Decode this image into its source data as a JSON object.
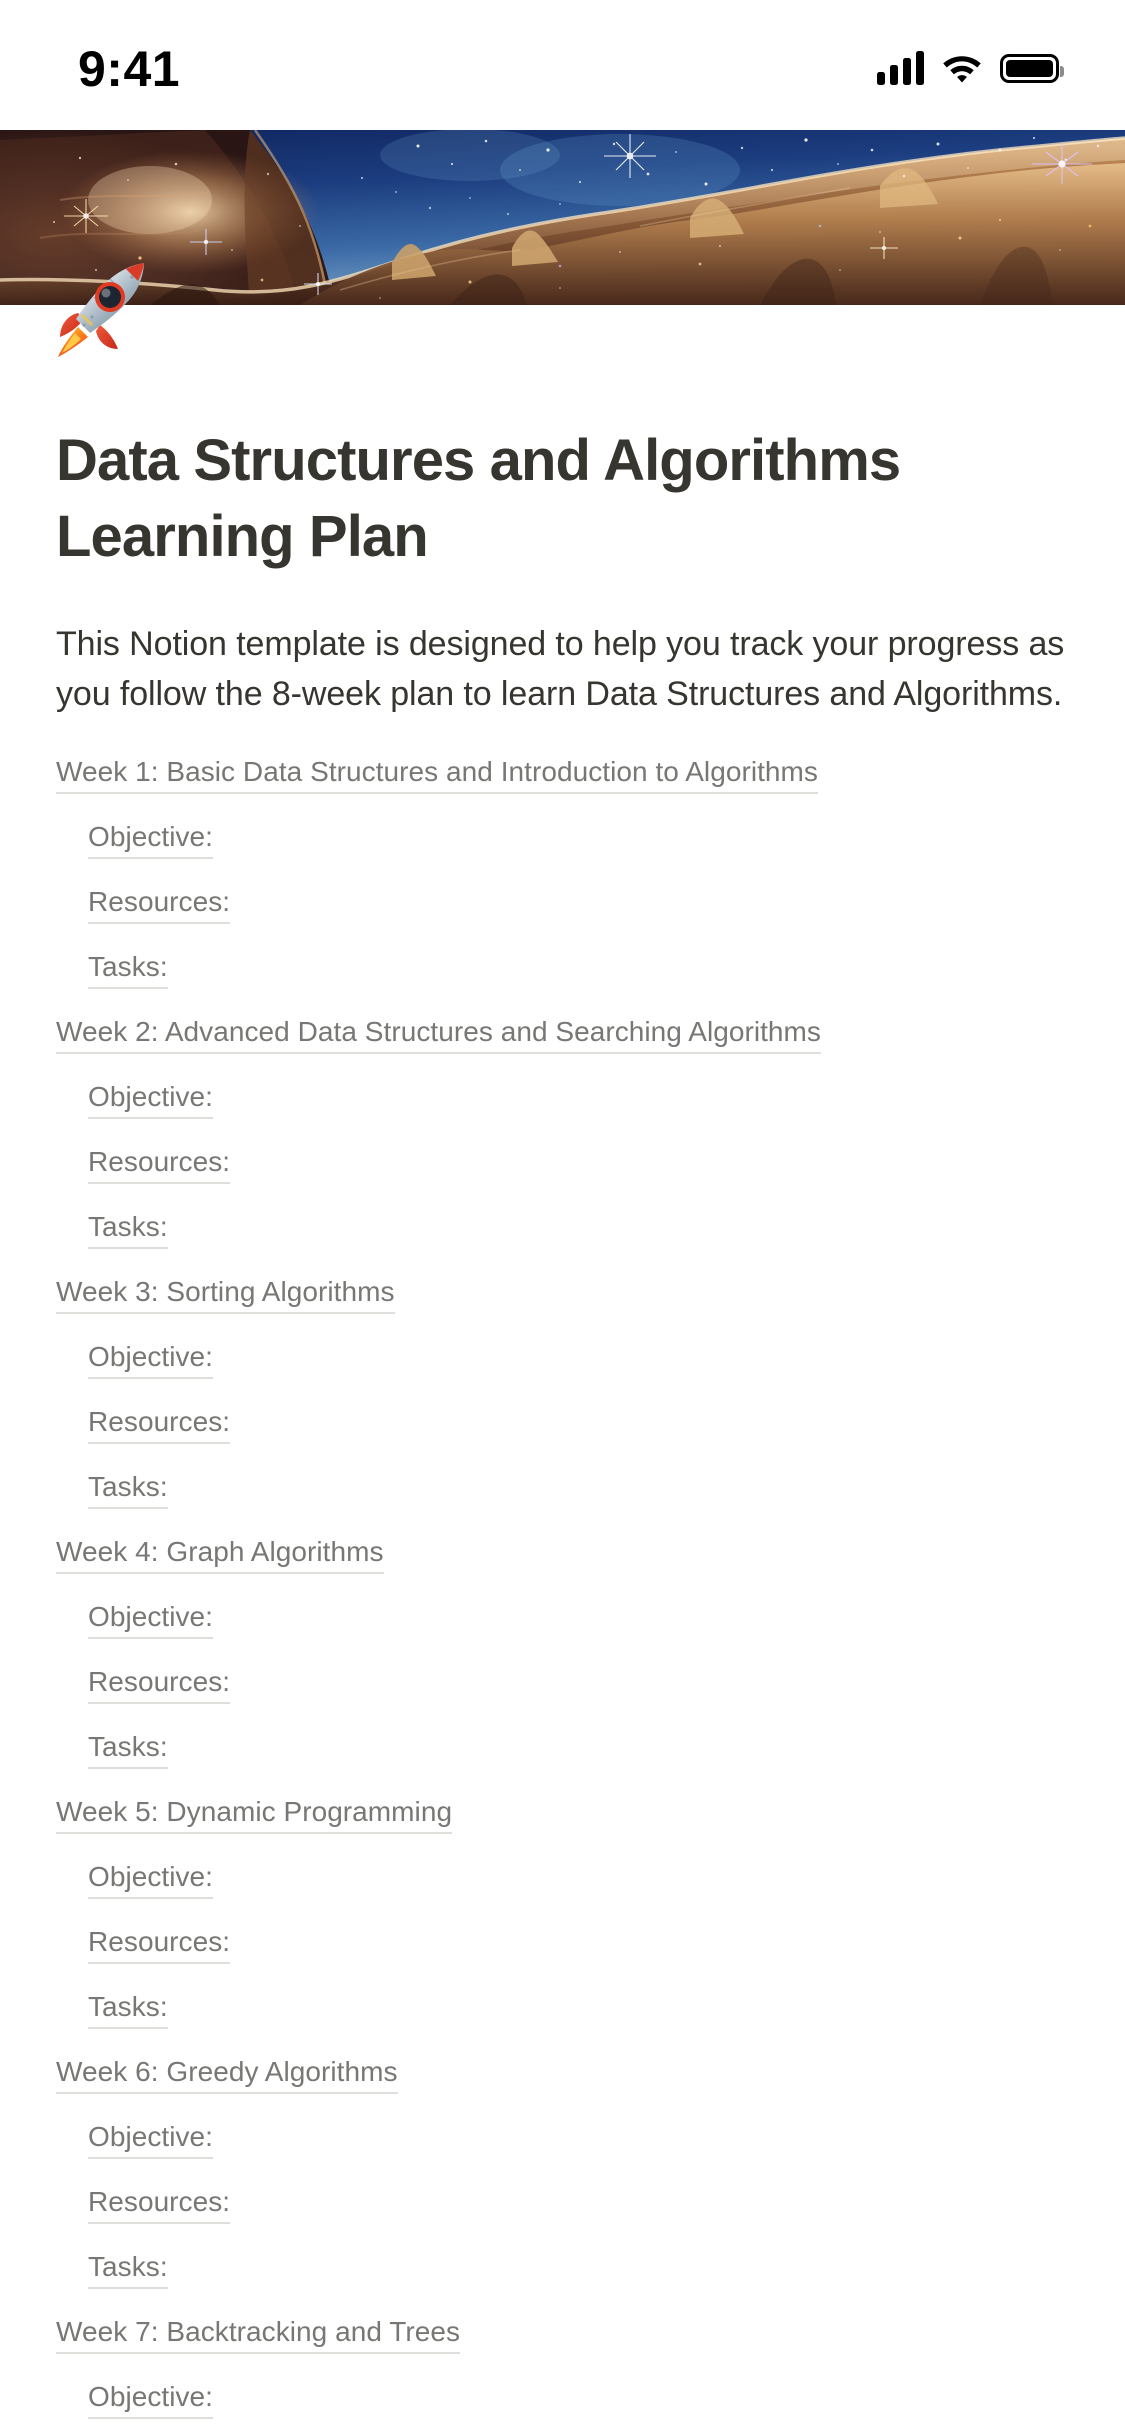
{
  "status_bar": {
    "time": "9:41",
    "cellular_icon": "cellular-bars-icon",
    "wifi_icon": "wifi-icon",
    "battery_icon": "battery-full-icon"
  },
  "cover": {
    "alt": "Cosmic Cliffs of the Carina Nebula",
    "name": "cover-image"
  },
  "page": {
    "icon": "rocket-emoji",
    "title": "Data Structures and Algorithms Learning Plan",
    "description": "This Notion template is designed to help you track your progress as you follow the 8-week plan to learn Data Structures and Algorithms."
  },
  "table_of_contents": [
    {
      "label": "Week 1: Basic Data Structures and Introduction to Algorithms",
      "level": 0
    },
    {
      "label": "Objective:",
      "level": 1
    },
    {
      "label": "Resources:",
      "level": 1
    },
    {
      "label": "Tasks:",
      "level": 1
    },
    {
      "label": "Week 2: Advanced Data Structures and Searching Algorithms",
      "level": 0
    },
    {
      "label": "Objective:",
      "level": 1
    },
    {
      "label": "Resources:",
      "level": 1
    },
    {
      "label": "Tasks:",
      "level": 1
    },
    {
      "label": "Week 3: Sorting Algorithms",
      "level": 0
    },
    {
      "label": "Objective:",
      "level": 1
    },
    {
      "label": "Resources:",
      "level": 1
    },
    {
      "label": "Tasks:",
      "level": 1
    },
    {
      "label": "Week 4: Graph Algorithms",
      "level": 0
    },
    {
      "label": "Objective:",
      "level": 1
    },
    {
      "label": "Resources:",
      "level": 1
    },
    {
      "label": "Tasks:",
      "level": 1
    },
    {
      "label": "Week 5: Dynamic Programming",
      "level": 0
    },
    {
      "label": "Objective:",
      "level": 1
    },
    {
      "label": "Resources:",
      "level": 1
    },
    {
      "label": "Tasks:",
      "level": 1
    },
    {
      "label": "Week 6: Greedy Algorithms",
      "level": 0
    },
    {
      "label": "Objective:",
      "level": 1
    },
    {
      "label": "Resources:",
      "level": 1
    },
    {
      "label": "Tasks:",
      "level": 1
    },
    {
      "label": "Week 7: Backtracking and Trees",
      "level": 0
    },
    {
      "label": "Objective:",
      "level": 1
    }
  ],
  "colors": {
    "text_primary": "#37352F",
    "text_muted": "#787774",
    "underline": "#DFDEDA",
    "background": "#FFFFFF"
  }
}
